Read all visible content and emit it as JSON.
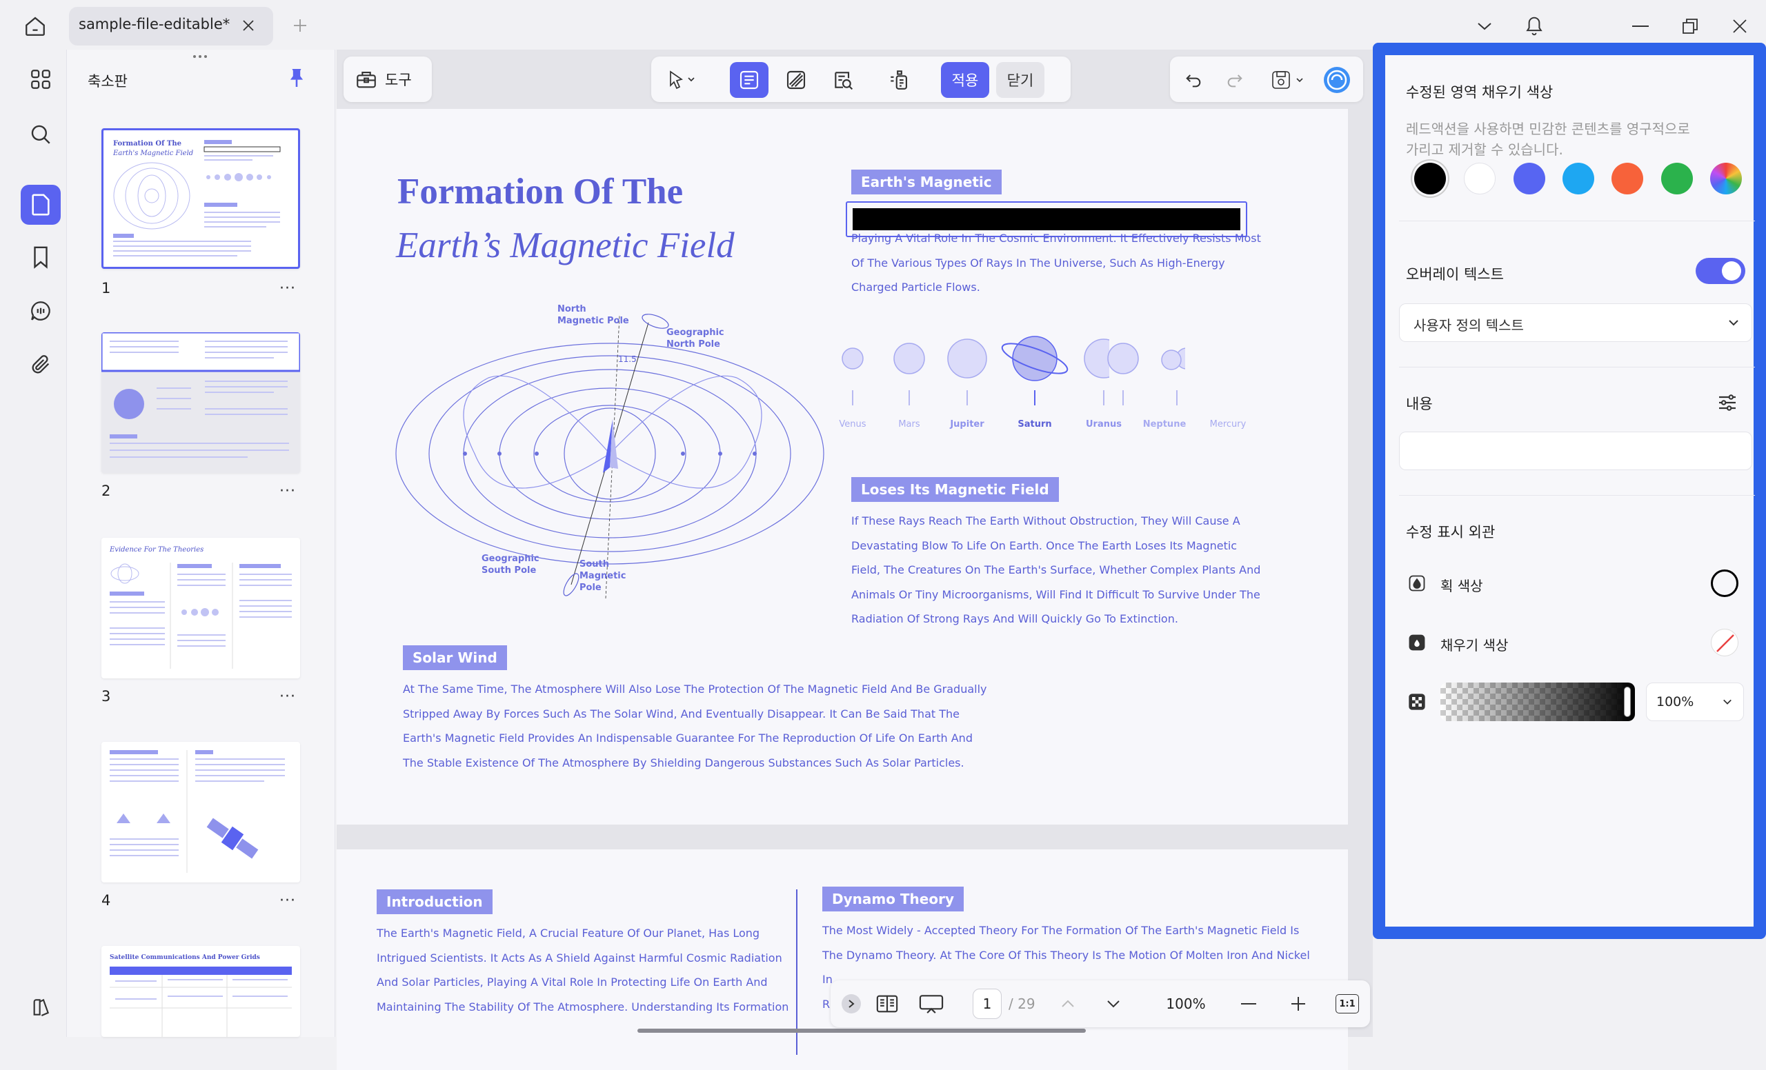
{
  "tab": {
    "title": "sample-file-editable*"
  },
  "thumbnails": {
    "title": "축소판",
    "pages": [
      {
        "number": "1",
        "more": "···"
      },
      {
        "number": "2",
        "more": "···"
      },
      {
        "number": "3",
        "more": "···"
      },
      {
        "number": "4",
        "more": "···"
      }
    ],
    "thumb1": {
      "title_a": "Formation Of The",
      "title_b": "Earth's Magnetic Field"
    },
    "thumb3": {
      "title": "Evidence For The Theories"
    },
    "thumb5": {
      "title": "Satellite Communications And Power Grids"
    }
  },
  "toolbar": {
    "tools_label": "도구",
    "apply_label": "적용",
    "close_label": "닫기"
  },
  "page1": {
    "title_line1": "Formation Of The",
    "title_line2": "Earth’s Magnetic Field",
    "diagram": {
      "north_magnetic_pole": "North Magnetic Pole",
      "geographic_north_pole": "Geographic North Pole",
      "angle": "11.5",
      "geographic_south_pole": "Geographic South Pole",
      "south_magnetic_pole": "South Magnetic Pole"
    },
    "earth_header": "Earth's Magnetic",
    "earth_text": [
      "Playing A Vital Role In The Cosmic Environment. It Effectively Resists Most",
      "Of The Various Types Of Rays In The Universe, Such As High-Energy",
      "Charged Particle Flows."
    ],
    "planets": [
      "Venus",
      "Mars",
      "Jupiter",
      "Saturn",
      "Uranus",
      "Neptune",
      "Mercury"
    ],
    "loses_header": "Loses Its Magnetic Field",
    "loses_text": [
      "If These Rays Reach The Earth Without Obstruction, They Will Cause A",
      "Devastating Blow To Life On Earth. Once The Earth Loses Its Magnetic",
      "Field, The Creatures On The Earth's Surface, Whether Complex Plants And",
      "Animals Or Tiny Microorganisms, Will Find It Difficult To Survive Under The",
      "Radiation Of Strong Rays And Will Quickly Go To Extinction."
    ],
    "solar_header": "Solar Wind",
    "solar_text": [
      "At The Same Time, The Atmosphere Will Also Lose The Protection Of The Magnetic Field And Be Gradually",
      "Stripped Away By Forces Such As The Solar Wind, And Eventually Disappear. It Can Be Said That The",
      "Earth's Magnetic Field Provides An Indispensable Guarantee For The Reproduction Of Life On Earth And",
      "The Stable Existence Of The Atmosphere By Shielding Dangerous Substances Such As Solar Particles."
    ]
  },
  "page2": {
    "intro_header": "Introduction",
    "intro_text": [
      "The Earth's Magnetic Field, A Crucial Feature Of Our Planet, Has Long",
      "Intrigued Scientists. It Acts As A Shield Against Harmful Cosmic Radiation",
      "And Solar Particles, Playing A Vital Role In Protecting Life On Earth And",
      "Maintaining The Stability Of The Atmosphere. Understanding Its Formation"
    ],
    "dynamo_header": "Dynamo Theory",
    "dynamo_text": [
      "The Most Widely - Accepted Theory For The Formation Of The Earth's Magnetic Field Is",
      "The Dynamo Theory. At The Core Of This Theory Is The Motion Of Molten Iron And Nickel",
      "In",
      "R"
    ]
  },
  "bottom_bar": {
    "page_current": "1",
    "page_total": "/ 29",
    "zoom": "100%",
    "fit_label": "1:1"
  },
  "panel": {
    "fill_title": "수정된 영역 채우기 색상",
    "fill_desc_line1": "레드액션을 사용하면 민감한 콘텐츠를 영구적으로",
    "fill_desc_line2": "가리고 제거할 수 있습니다.",
    "colors": [
      "#000000",
      "#ffffff",
      "#5765f2",
      "#1ea7f2",
      "#f7623a",
      "#2bb24c",
      "rainbow"
    ],
    "overlay_title": "오버레이 텍스트",
    "overlay_on": true,
    "overlay_select": "사용자 정의 텍스트",
    "content_title": "내용",
    "content_value": "",
    "appearance_title": "수정 표시 외관",
    "stroke_label": "획 색상",
    "fill_label": "채우기 색상",
    "opacity": "100%"
  }
}
